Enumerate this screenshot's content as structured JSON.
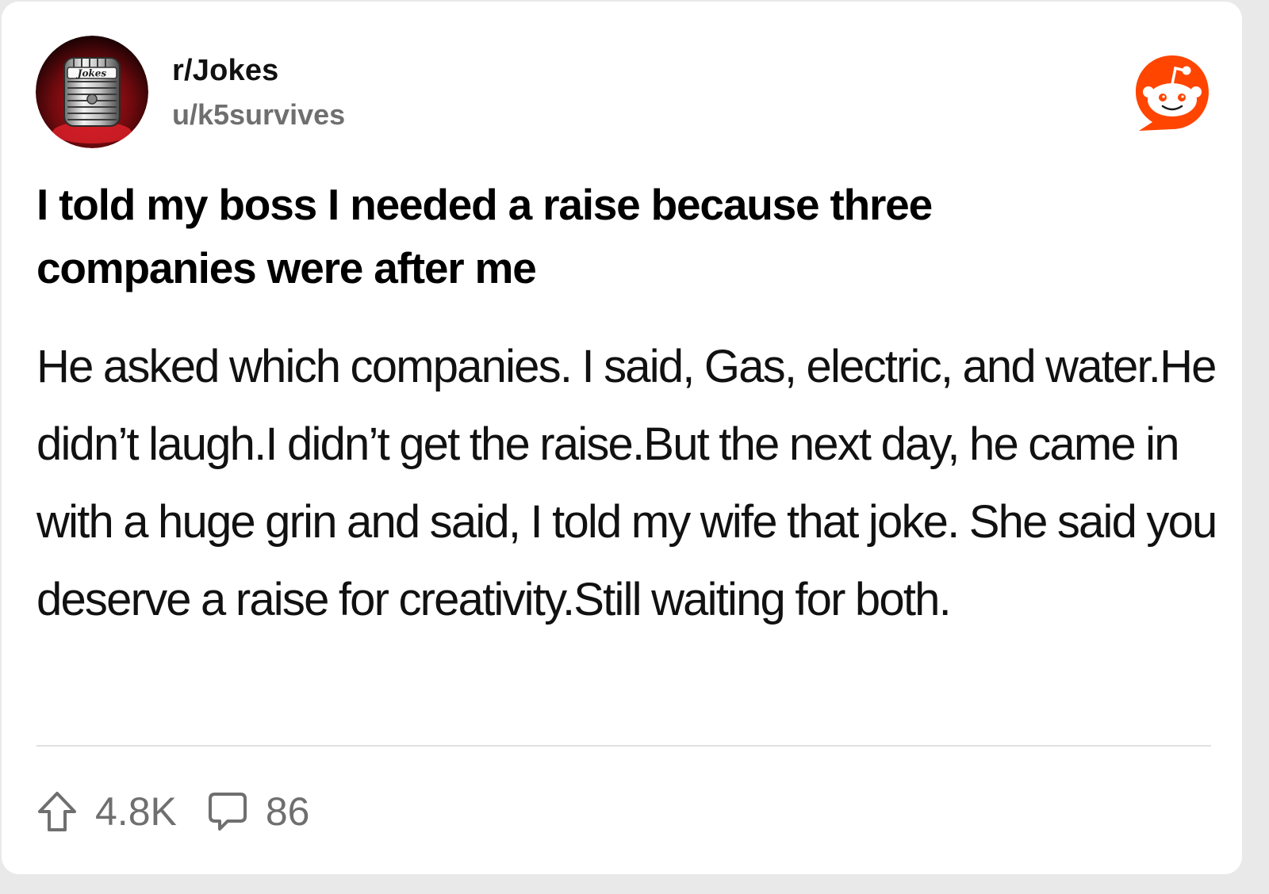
{
  "post": {
    "subreddit": "r/Jokes",
    "author": "u/k5survives",
    "avatar_label": "Jokes",
    "title": "I told my boss I needed a raise because three companies were after me",
    "body": "He asked which companies. I said, Gas, electric, and water.He didn’t laugh.I didn’t get the raise.But the next day, he came in with a huge grin and said, I told my wife that joke. She said you deserve a raise for creativity.Still waiting for both.",
    "upvotes": "4.8K",
    "comments": "86"
  },
  "icons": {
    "brand": "reddit-logo-icon",
    "upvote": "upvote-arrow-icon",
    "comments": "comment-bubble-icon"
  },
  "colors": {
    "reddit_orange": "#FF4500",
    "title_text": "#000000",
    "meta_text": "#6F6F6F",
    "divider": "#E1E1E1"
  }
}
